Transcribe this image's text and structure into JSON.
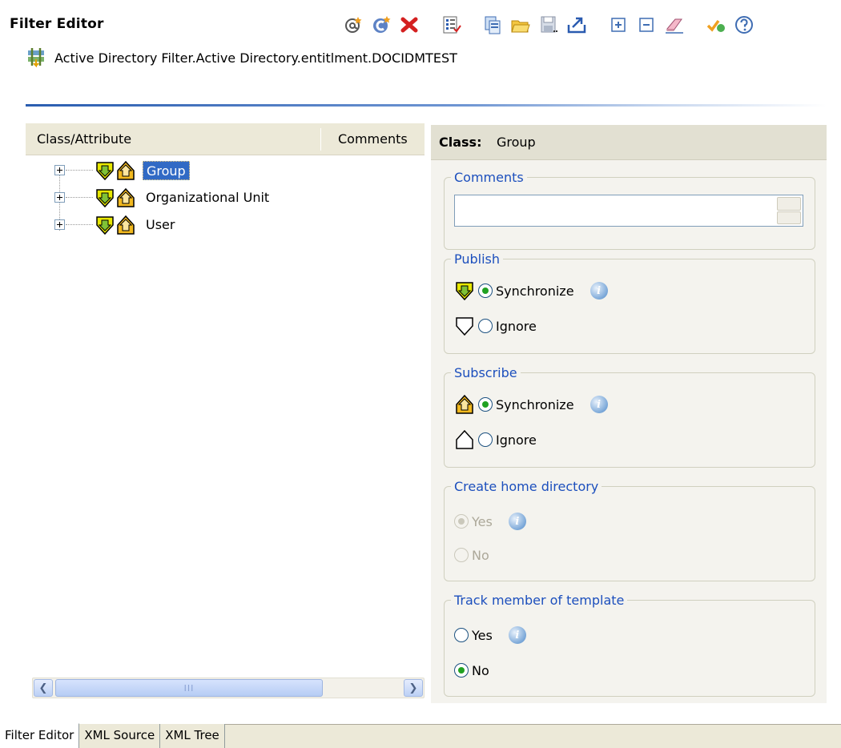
{
  "app": {
    "title": "Filter Editor"
  },
  "toolbar": {
    "icons": [
      "add-attribute-icon",
      "add-class-icon",
      "delete-icon",
      "properties-icon",
      "copy-icon",
      "open-folder-icon",
      "save-icon",
      "export-icon",
      "expand-all-icon",
      "collapse-all-icon",
      "eraser-icon",
      "validate-icon",
      "help-icon"
    ]
  },
  "path": {
    "text": "Active Directory Filter.Active Directory.entitlment.DOCIDMTEST"
  },
  "tree": {
    "headers": {
      "class_attribute": "Class/Attribute",
      "comments": "Comments"
    },
    "items": [
      {
        "label": "Group",
        "selected": true
      },
      {
        "label": "Organizational Unit",
        "selected": false
      },
      {
        "label": "User",
        "selected": false
      }
    ],
    "scroll_thumb_text": "III"
  },
  "props": {
    "class_label": "Class:",
    "class_value": "Group",
    "comments": {
      "legend": "Comments",
      "value": ""
    },
    "publish": {
      "legend": "Publish",
      "options": [
        {
          "label": "Synchronize",
          "selected": true
        },
        {
          "label": "Ignore",
          "selected": false
        }
      ]
    },
    "subscribe": {
      "legend": "Subscribe",
      "options": [
        {
          "label": "Synchronize",
          "selected": true
        },
        {
          "label": "Ignore",
          "selected": false
        }
      ]
    },
    "create_home": {
      "legend": "Create home directory",
      "enabled": false,
      "options": [
        {
          "label": "Yes",
          "selected": true
        },
        {
          "label": "No",
          "selected": false
        }
      ]
    },
    "track_member": {
      "legend": "Track member of template",
      "options": [
        {
          "label": "Yes",
          "selected": false
        },
        {
          "label": "No",
          "selected": true
        }
      ]
    },
    "info_glyph": "i"
  },
  "tabs": [
    {
      "label": "Filter Editor",
      "active": true
    },
    {
      "label": "XML Source",
      "active": false
    },
    {
      "label": "XML Tree",
      "active": false
    }
  ],
  "colors": {
    "legend_blue": "#1c4fbd",
    "selection_blue": "#316ac5",
    "sync_yellow": "#e8e800",
    "sub_orange": "#f2b91f",
    "radio_green": "#21a121"
  }
}
